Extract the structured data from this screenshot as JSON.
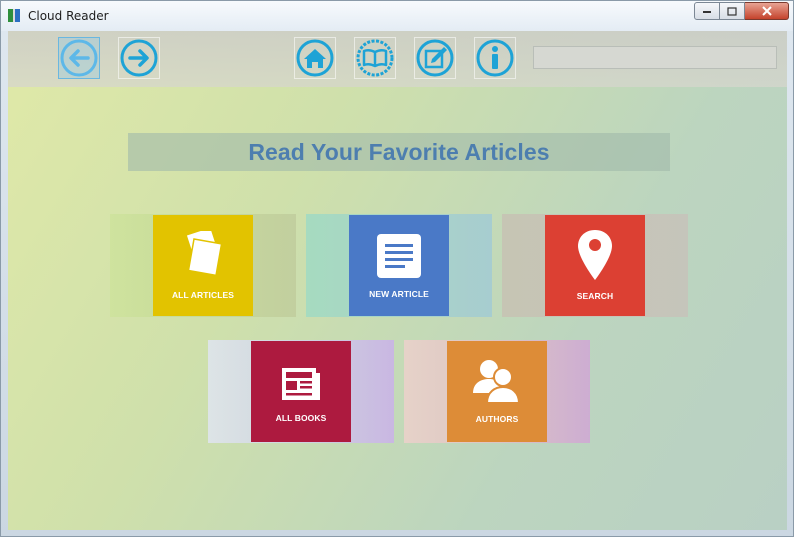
{
  "window": {
    "title": "Cloud Reader"
  },
  "toolbar": {
    "buttons": [
      {
        "icon": "back-arrow-icon",
        "color": "#5db8e8",
        "active": true
      },
      {
        "icon": "forward-arrow-icon",
        "color": "#1ea3d6",
        "active": false
      },
      {
        "icon": "home-icon",
        "color": "#1ea3d6",
        "active": false
      },
      {
        "icon": "book-icon",
        "color": "#1ea3d6",
        "active": false
      },
      {
        "icon": "edit-icon",
        "color": "#1ea3d6",
        "active": false
      },
      {
        "icon": "info-icon",
        "color": "#1ea3d6",
        "active": false
      }
    ],
    "search": {
      "value": "",
      "placeholder": ""
    }
  },
  "main": {
    "heading": "Read Your Favorite Articles",
    "tiles": [
      {
        "label": "ALL ARTICLES",
        "icon": "articles-icon",
        "color": "#e2c300"
      },
      {
        "label": "NEW ARTICLE",
        "icon": "document-icon",
        "color": "#4a79c7"
      },
      {
        "label": "SEARCH",
        "icon": "map-pin-icon",
        "color": "#dc4033"
      },
      {
        "label": "ALL BOOKS",
        "icon": "newspaper-icon",
        "color": "#ad1a3f"
      },
      {
        "label": "AUTHORS",
        "icon": "users-icon",
        "color": "#dd8c37"
      }
    ]
  }
}
